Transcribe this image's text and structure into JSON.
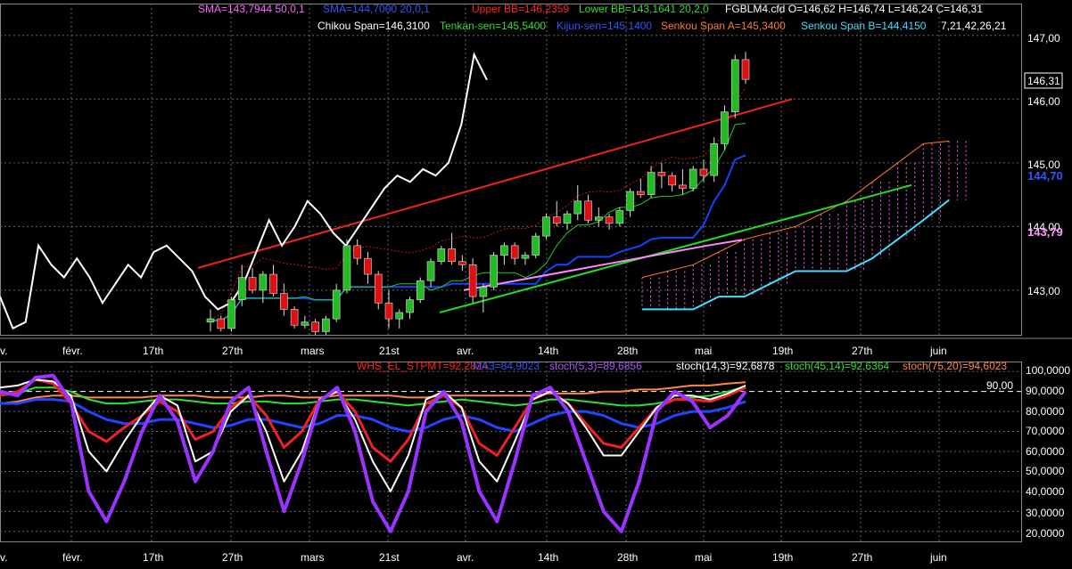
{
  "header": {
    "row1": [
      {
        "text": "SMA=143,7944  50,0,1",
        "color": "#ff66ff"
      },
      {
        "text": "SMA=144,7000  20,0,1",
        "color": "#3355ff"
      },
      {
        "text": "Upper BB=146,2359",
        "color": "#ff2222"
      },
      {
        "text": "Lower BB=143,1641  20,2,0",
        "color": "#33dd33"
      },
      {
        "text": "FGBLM4.cfd O=146,62 H=146,74 L=146,24 C=146,31",
        "color": "#ffffff"
      }
    ],
    "row2": [
      {
        "text": "Chikou Span=146,3100",
        "color": "#ffffff"
      },
      {
        "text": "Tenkan-sen=145,5400",
        "color": "#33dd33"
      },
      {
        "text": "Kijun-sen=145,1400",
        "color": "#3355ff"
      },
      {
        "text": "Senkou Span A=145,3400",
        "color": "#ff7733"
      },
      {
        "text": "Senkou Span B=144,4150",
        "color": "#44ddff"
      },
      {
        "text": "7,21,42,26,21",
        "color": "#ffffff"
      }
    ]
  },
  "oscillator_header": [
    {
      "text": "WHS_EL_STPMT=92,2824",
      "color": "#ff2222"
    },
    {
      "text": "MA3=84,9023",
      "color": "#3355ff"
    },
    {
      "text": "stoch(5,3)=89,6856",
      "color": "#aa55ff"
    },
    {
      "text": "stoch(14,3)=92,6878",
      "color": "#ffffff"
    },
    {
      "text": "stoch(45,14)=92,6364",
      "color": "#33dd33"
    },
    {
      "text": "stoch(75,20)=94,6023",
      "color": "#ff8844"
    }
  ],
  "price_axis": {
    "ticks": [
      "147,00",
      "146,00",
      "145,00",
      "144,00",
      "143,00"
    ],
    "current_label": "146,31",
    "sma20_label": "144,70",
    "sma50_label": "143,79"
  },
  "osc_axis": {
    "ticks": [
      "100,0000",
      "90,0000",
      "80,0000",
      "70,0000",
      "60,0000",
      "50,0000",
      "40,0000",
      "30,0000",
      "20,0000"
    ],
    "level_label": "90,00"
  },
  "time_labels": [
    "v.",
    "févr.",
    "17th",
    "27th",
    "mars",
    "21st",
    "avr.",
    "14th",
    "28th",
    "mai",
    "19th",
    "27th",
    "juin"
  ],
  "colors": {
    "background": "#000000",
    "grid": "#555555",
    "bull": "#22bb22",
    "bear": "#dd1111"
  },
  "chart_data": [
    {
      "type": "candlestick",
      "symbol": "FGBLM4.cfd",
      "ylim": [
        142.3,
        147.5
      ],
      "last": {
        "open": 146.62,
        "high": 146.74,
        "low": 146.24,
        "close": 146.31
      },
      "candles": [
        [
          142.5,
          142.7,
          142.35,
          142.55
        ],
        [
          142.55,
          142.6,
          142.35,
          142.4
        ],
        [
          142.4,
          142.9,
          142.35,
          142.85
        ],
        [
          142.85,
          143.4,
          142.75,
          143.2
        ],
        [
          143.2,
          143.35,
          142.95,
          143.0
        ],
        [
          143.0,
          143.3,
          142.8,
          143.25
        ],
        [
          143.25,
          143.4,
          142.9,
          142.95
        ],
        [
          142.95,
          143.1,
          142.6,
          142.7
        ],
        [
          142.7,
          142.75,
          142.4,
          142.45
        ],
        [
          142.45,
          142.6,
          142.4,
          142.5
        ],
        [
          142.5,
          142.55,
          142.3,
          142.35
        ],
        [
          142.35,
          142.6,
          142.3,
          142.55
        ],
        [
          142.55,
          143.1,
          142.5,
          143.0
        ],
        [
          143.0,
          143.8,
          142.95,
          143.7
        ],
        [
          143.7,
          143.8,
          143.4,
          143.5
        ],
        [
          143.5,
          143.6,
          143.1,
          143.25
        ],
        [
          143.25,
          143.3,
          142.7,
          142.8
        ],
        [
          142.8,
          143.0,
          142.4,
          142.55
        ],
        [
          142.55,
          142.7,
          142.4,
          142.65
        ],
        [
          142.65,
          142.9,
          142.55,
          142.85
        ],
        [
          142.85,
          143.2,
          142.8,
          143.15
        ],
        [
          143.15,
          143.5,
          143.05,
          143.45
        ],
        [
          143.45,
          143.7,
          143.4,
          143.65
        ],
        [
          143.65,
          143.9,
          143.4,
          143.45
        ],
        [
          143.45,
          143.55,
          143.3,
          143.4
        ],
        [
          143.4,
          143.5,
          142.8,
          142.9
        ],
        [
          142.9,
          143.1,
          142.65,
          143.05
        ],
        [
          143.05,
          143.6,
          143.0,
          143.55
        ],
        [
          143.55,
          143.75,
          143.4,
          143.7
        ],
        [
          143.7,
          143.75,
          143.4,
          143.5
        ],
        [
          143.5,
          143.6,
          143.4,
          143.55
        ],
        [
          143.55,
          143.9,
          143.5,
          143.85
        ],
        [
          143.85,
          144.2,
          143.8,
          144.15
        ],
        [
          144.15,
          144.4,
          144.0,
          144.05
        ],
        [
          144.05,
          144.25,
          143.95,
          144.2
        ],
        [
          144.2,
          144.65,
          144.1,
          144.4
        ],
        [
          144.4,
          144.5,
          144.05,
          144.1
        ],
        [
          144.1,
          144.3,
          144.0,
          144.15
        ],
        [
          144.15,
          144.2,
          143.95,
          144.05
        ],
        [
          144.05,
          144.3,
          144.0,
          144.25
        ],
        [
          144.25,
          144.6,
          144.15,
          144.55
        ],
        [
          144.55,
          144.75,
          144.45,
          144.5
        ],
        [
          144.5,
          144.95,
          144.45,
          144.85
        ],
        [
          144.85,
          145.0,
          144.6,
          144.8
        ],
        [
          144.8,
          144.85,
          144.55,
          144.65
        ],
        [
          144.65,
          144.9,
          144.5,
          144.6
        ],
        [
          144.6,
          144.95,
          144.55,
          144.9
        ],
        [
          144.9,
          145.05,
          144.7,
          144.8
        ],
        [
          144.8,
          145.4,
          144.7,
          145.3
        ],
        [
          145.3,
          145.9,
          145.2,
          145.8
        ],
        [
          145.8,
          146.7,
          145.7,
          146.62
        ],
        [
          146.62,
          146.74,
          146.24,
          146.31
        ]
      ],
      "series": [
        {
          "name": "Chikou Span",
          "values": [
            142.9,
            142.4,
            142.5,
            143.7,
            143.4,
            143.2,
            143.5,
            143.2,
            142.8,
            143.1,
            143.4,
            143.2,
            143.6,
            143.7,
            143.5,
            143.3,
            142.9,
            142.7,
            142.8,
            143.1,
            143.6,
            144.1,
            143.7,
            144.0,
            144.4,
            144.2,
            143.9,
            143.7,
            144.0,
            144.3,
            144.6,
            144.8,
            144.7,
            144.9,
            144.8,
            145.0,
            145.6,
            146.7,
            146.3
          ]
        },
        {
          "name": "Tenkan-sen",
          "values": []
        },
        {
          "name": "Kijun-sen",
          "values": []
        },
        {
          "name": "Senkou Span A",
          "values": []
        },
        {
          "name": "Senkou Span B",
          "values": []
        }
      ]
    },
    {
      "type": "line",
      "ylim": [
        15,
        105
      ],
      "level": 90,
      "series": [
        {
          "name": "stoch(5,3)",
          "values": [
            90,
            88,
            97,
            98,
            85,
            40,
            25,
            45,
            70,
            88,
            75,
            45,
            60,
            85,
            92,
            60,
            30,
            55,
            85,
            92,
            70,
            35,
            20,
            40,
            80,
            90,
            75,
            40,
            25,
            55,
            88,
            92,
            80,
            55,
            30,
            20,
            45,
            80,
            90,
            85,
            72,
            78,
            90
          ]
        },
        {
          "name": "stoch(14,3)",
          "values": [
            92,
            93,
            96,
            95,
            88,
            60,
            50,
            65,
            78,
            88,
            83,
            55,
            60,
            80,
            88,
            70,
            45,
            60,
            86,
            90,
            76,
            55,
            40,
            58,
            86,
            90,
            82,
            55,
            45,
            65,
            86,
            90,
            84,
            72,
            58,
            58,
            70,
            82,
            88,
            88,
            86,
            89,
            93
          ]
        },
        {
          "name": "WHS_EL_STPMT",
          "values": [
            88,
            90,
            96,
            94,
            84,
            70,
            65,
            72,
            78,
            85,
            80,
            66,
            70,
            82,
            88,
            78,
            62,
            70,
            86,
            90,
            80,
            62,
            55,
            66,
            84,
            88,
            82,
            64,
            58,
            72,
            86,
            90,
            84,
            74,
            64,
            62,
            72,
            82,
            86,
            86,
            85,
            88,
            92
          ]
        },
        {
          "name": "MA3",
          "values": [
            84,
            84,
            86,
            86,
            85,
            80,
            76,
            74,
            74,
            76,
            76,
            74,
            72,
            73,
            76,
            76,
            74,
            72,
            74,
            78,
            78,
            76,
            72,
            70,
            72,
            76,
            78,
            76,
            72,
            70,
            74,
            78,
            80,
            80,
            78,
            74,
            72,
            74,
            78,
            80,
            80,
            82,
            85
          ]
        },
        {
          "name": "stoch(45,14)",
          "values": [
            88,
            89,
            92,
            92,
            90,
            86,
            84,
            84,
            85,
            86,
            86,
            85,
            84,
            84,
            85,
            85,
            84,
            84,
            85,
            86,
            86,
            85,
            84,
            83,
            84,
            85,
            86,
            85,
            84,
            83,
            84,
            86,
            86,
            85,
            84,
            83,
            83,
            84,
            86,
            87,
            88,
            90,
            92.6
          ]
        },
        {
          "name": "stoch(75,20)",
          "values": [
            84,
            85,
            87,
            88,
            88,
            87,
            87,
            87,
            87,
            88,
            88,
            88,
            87,
            87,
            87,
            88,
            88,
            87,
            87,
            88,
            88,
            88,
            88,
            87,
            87,
            88,
            88,
            88,
            88,
            88,
            88,
            89,
            89,
            89,
            90,
            90,
            91,
            91,
            92,
            93,
            93,
            94,
            94.6
          ]
        }
      ]
    }
  ]
}
